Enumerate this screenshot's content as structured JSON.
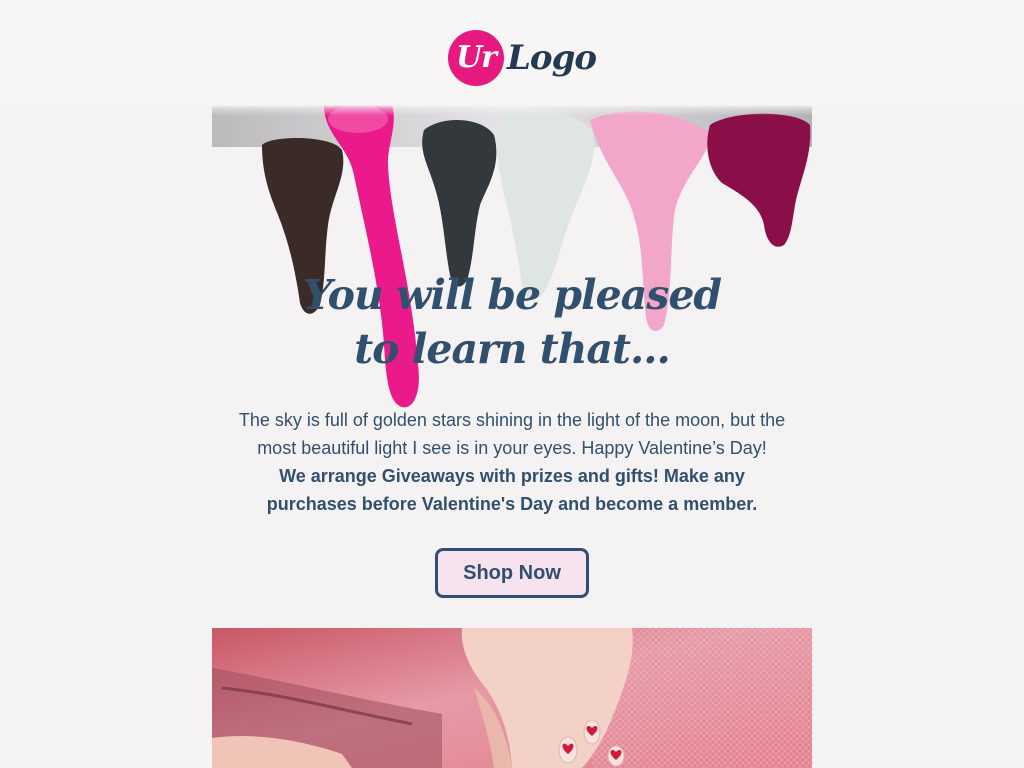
{
  "logo": {
    "circle_text": "Ur",
    "word_text": "Logo",
    "brand_color": "#e5197e",
    "text_color": "#233a52"
  },
  "hero": {
    "image": "nail-polish-drips",
    "headline_line1": "You will be pleased",
    "headline_line2": "to learn that..."
  },
  "body": {
    "text": "The sky is full of golden stars shining in the light of the moon, but the most beautiful light I see is in your eyes. Happy Valentine’s Day!",
    "bold_text": "We arrange Giveaways with prizes and gifts! Make any purchases before Valentine's Day and become a member."
  },
  "cta": {
    "label": "Shop Now",
    "border_color": "#30506e",
    "background_color": "#f6e3ef"
  },
  "photo": {
    "image": "hands-with-valentine-nails"
  },
  "colors": {
    "page_background": "#f5f2f4",
    "heading": "#30506e"
  }
}
